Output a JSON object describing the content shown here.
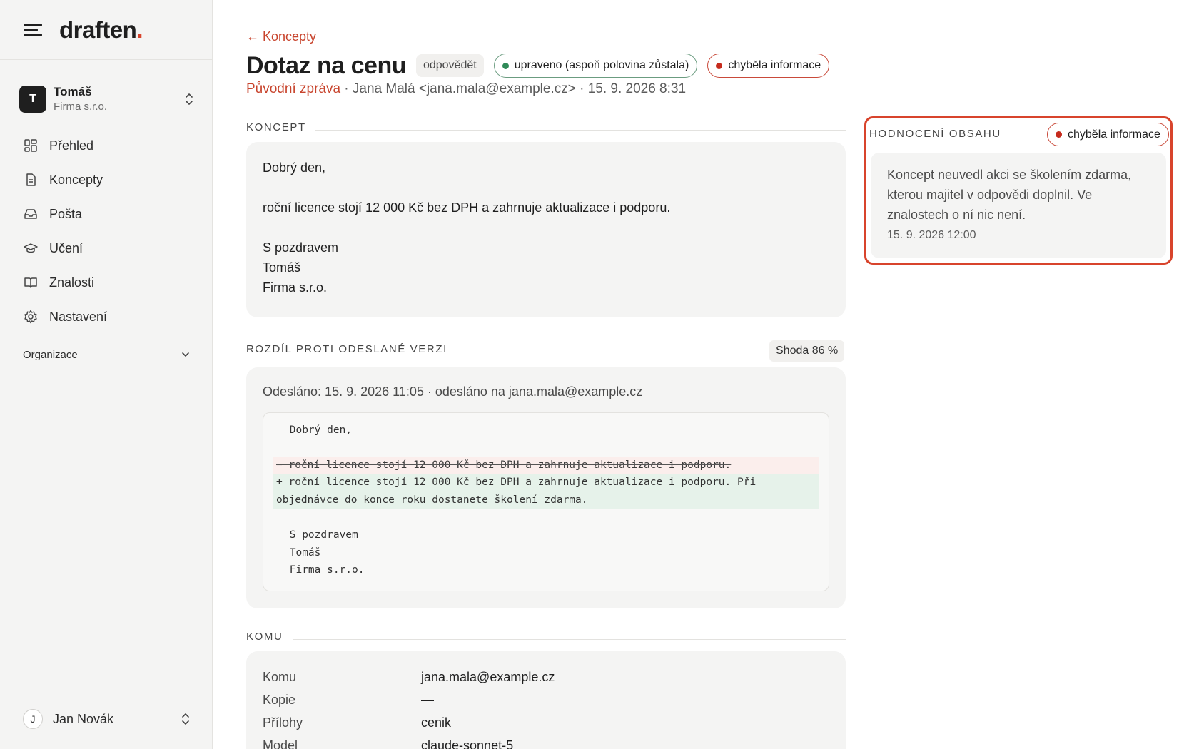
{
  "brand": {
    "logo_text": "draften",
    "logo_dot": ".",
    "accent": "#d8442c"
  },
  "account": {
    "initial": "T",
    "name": "Tomáš",
    "org": "Firma s.r.o."
  },
  "nav": [
    {
      "label": "Přehled",
      "icon": "dashboard-icon"
    },
    {
      "label": "Koncepty",
      "icon": "document-icon"
    },
    {
      "label": "Pošta",
      "icon": "inbox-icon"
    },
    {
      "label": "Učení",
      "icon": "graduation-cap-icon"
    },
    {
      "label": "Znalosti",
      "icon": "book-icon"
    },
    {
      "label": "Nastavení",
      "icon": "gear-icon"
    }
  ],
  "organization": {
    "label": "Organizace"
  },
  "user": {
    "initial": "J",
    "name": "Jan Novák"
  },
  "header": {
    "back": "← Koncepty",
    "title": "Dotaz na cenu",
    "type_chip": "odpovědět",
    "status_green": "upraveno (aspoň polovina zůstala)",
    "status_red": "chyběla informace",
    "meta_link": "Původní zpráva",
    "meta_rest": " · Jana Malá <jana.mala@example.cz> · 15. 9. 2026 8:31"
  },
  "concept": {
    "label": "KONCEPT",
    "lines": [
      "Dobrý den,",
      "",
      "roční licence stojí 12 000 Kč bez DPH a zahrnuje aktualizace i podporu.",
      "",
      "S pozdravem",
      "Tomáš",
      "Firma s.r.o."
    ]
  },
  "diff": {
    "label": "ROZDÍL PROTI ODESLANÉ VERZI",
    "match": "Shoda 86 %",
    "sent": "Odesláno: 15. 9. 2026 11:05 · odesláno na jana.mala@example.cz",
    "greeting": " Dobrý den,",
    "removed": "− roční licence stojí 12 000 Kč bez DPH a zahrnuje aktualizace i podporu.",
    "added": "+ roční licence stojí 12 000 Kč bez DPH a zahrnuje aktualizace i podporu. Při objednávce do konce roku dostanete školení zdarma.",
    "closing_1": " S pozdravem",
    "closing_2": " Tomáš",
    "closing_3": " Firma s.r.o."
  },
  "recipients": {
    "label": "KOMU",
    "rows": [
      {
        "key": "Komu",
        "value": "jana.mala@example.cz"
      },
      {
        "key": "Kopie",
        "value": "—"
      },
      {
        "key": "Přílohy",
        "value": "cenik"
      },
      {
        "key": "Model",
        "value": "claude-sonnet-5"
      }
    ]
  },
  "evaluation": {
    "label": "HODNOCENÍ OBSAHU",
    "status": "chyběla informace",
    "text": "Koncept neuvedl akci se školením zdarma, kterou majitel v odpovědi doplnil. Ve znalostech o ní nic není.",
    "time": "15. 9. 2026 12:00"
  },
  "colors": {
    "accent_red": "#c8442d",
    "status_green": "#2f8a58",
    "status_red": "#c62b1d",
    "highlight_border": "#d8442c"
  }
}
